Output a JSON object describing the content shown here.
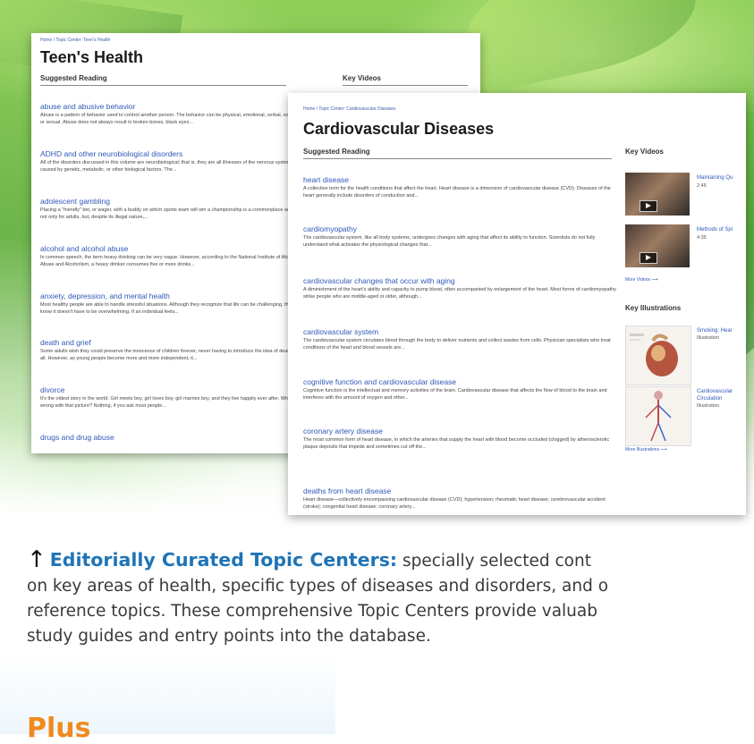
{
  "colors": {
    "accent_blue": "#1f74b5",
    "link_blue": "#2f58b8",
    "orange": "#f08a1e"
  },
  "card_back": {
    "breadcrumb": "Home / Topic Center: Teen's Health",
    "title": "Teen's Health",
    "suggested_reading": "Suggested Reading",
    "key_videos": "Key Videos",
    "items": [
      {
        "title": "abuse and abusive behavior",
        "desc": "Abuse is a pattern of behavior used to control another person. The behavior can be physical, emotional, verbal, social, or sexual. Abuse does not always result in broken bones, black eyes..."
      },
      {
        "title": "ADHD and other neurobiological disorders",
        "desc": "All of the disorders discussed in this volume are neurobiological; that is, they are all illnesses of the nervous system caused by genetic, metabolic, or other biological factors. The..."
      },
      {
        "title": "adolescent gambling",
        "desc": "Placing a \"friendly\" bet, or wager, with a buddy on which sports team will win a championship is a commonplace activity not only for adults, but, despite its illegal nature,..."
      },
      {
        "title": "alcohol and alcohol abuse",
        "desc": "In common speech, the term heavy drinking can be very vague. However, according to the National Institute of Alcohol Abuse and Alcoholism, a heavy drinker consumes five or more drinks..."
      },
      {
        "title": "anxiety, depression, and mental health",
        "desc": "Most healthy people are able to handle stressful situations. Although they recognize that life can be challenging, they know it doesn't have to be overwhelming. If an individual feels..."
      },
      {
        "title": "death and grief",
        "desc": "Some adults wish they could preserve the innocence of children forever, never having to introduce the idea of death at all. However, as young people become more and more independent, it..."
      },
      {
        "title": "divorce",
        "desc": "It's the oldest story in the world. Girl meets boy, girl loves boy, girl marries boy, and they live happily ever after. What's wrong with that picture? Nothing, if you ask most people..."
      },
      {
        "title": "drugs and drug abuse",
        "desc": ""
      }
    ]
  },
  "card_front": {
    "breadcrumb": "Home / Topic Center: Cardiovascular Diseases",
    "title": "Cardiovascular Diseases",
    "suggested_reading": "Suggested Reading",
    "key_videos": "Key Videos",
    "key_illustrations": "Key Illustrations",
    "more_videos": "More Videos ⟶",
    "more_illustrations": "More Illustrations ⟶",
    "videos": [
      {
        "title": "Maintaining Qu",
        "duration": "2:45"
      },
      {
        "title": "Methods of Spi",
        "duration": "4:35"
      }
    ],
    "illustrations": [
      {
        "title": "Smoking: Hear",
        "kind": "Illustration"
      },
      {
        "title": "Cardiovascular Circulation",
        "kind": "Illustration"
      }
    ],
    "items": [
      {
        "title": "heart disease",
        "desc": "A collective term for the health conditions that affect the heart. Heart disease is a dimension of cardiovascular disease (CVD). Diseases of the heart generally include disorders of conduction and..."
      },
      {
        "title": "cardiomyopathy",
        "desc": "The cardiovascular system, like all body systems, undergoes changes with aging that affect its ability to function. Scientists do not fully understand what activates the physiological changes that..."
      },
      {
        "title": "cardiovascular changes that occur with aging",
        "desc": "A diminishment of the heart's ability and capacity to pump blood, often accompanied by enlargement of the heart. Most forms of cardiomyopathy strike people who are middle-aged or older, although..."
      },
      {
        "title": "cardiovascular system",
        "desc": "The cardiovascular system circulates blood through the body to deliver nutrients and collect wastes from cells. Physician specialists who treat conditions of the heart and blood vessels are..."
      },
      {
        "title": "cognitive function and cardiovascular disease",
        "desc": "Cognitive function is the intellectual and memory activities of the brain. Cardiovascular disease that affects the flow of blood to the brain and interferes with the amount of oxygen and other..."
      },
      {
        "title": "coronary artery disease",
        "desc": "The most common form of heart disease, in which the arteries that supply the heart with blood become occluded (clogged) by atherosclerotic plaque deposits that impede and sometimes cut off the..."
      },
      {
        "title": "deaths from heart disease",
        "desc": "Heart disease—collectively encompassing cardiovascular disease (CVD); hypertension; rheumatic heart disease; cerebrovascular accident (stroke); congenital heart disease; coronary artery..."
      }
    ]
  },
  "caption": {
    "arrow": "↑",
    "highlight": "Editorially Curated Topic Centers:",
    "line1": " specially selected cont",
    "line2": "on key areas of health, specific types of diseases and disorders, and o",
    "line3": "reference topics. These comprehensive Topic Centers provide valuab",
    "line4": "study guides and entry points into the database."
  },
  "plus_heading": "Plus"
}
